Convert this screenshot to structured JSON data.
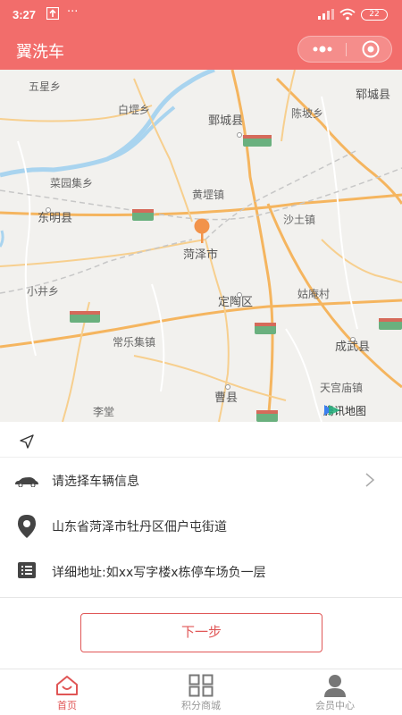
{
  "status_bar": {
    "time": "3:27",
    "ellipsis": "···",
    "battery": "22"
  },
  "title_bar": {
    "title": "翼洗车"
  },
  "map": {
    "labels": {
      "wuxingxiang": "五星乡",
      "baiduxiang": "白堽乡",
      "juanchengxian": "鄄城县",
      "chenpoxiang": "陈坡乡",
      "yunchengxian": "郓城县",
      "caiyuanjixiang": "菜园集乡",
      "huangdizhen": "黄堽镇",
      "dongmingxian": "东明县",
      "shatuzhen": "沙土镇",
      "hezeshi": "菏泽市",
      "xiaojingxiang": "小井乡",
      "dingtaoqu": "定陶区",
      "guanmiaocun": "姑庵村",
      "changlejizhen": "常乐集镇",
      "chengwuxian": "成武县",
      "caoxian": "曹县",
      "tiangongmiaozhen": "天宫庙镇",
      "litang": "李堂"
    },
    "watermark": "腾讯地图"
  },
  "form": {
    "vehicle_placeholder": "请选择车辆信息",
    "address": "山东省菏泽市牡丹区佃户屯街道",
    "detail_placeholder": "详细地址:如xx写字楼x栋停车场负一层"
  },
  "next_button": "下一步",
  "tabs": [
    {
      "label": "首页"
    },
    {
      "label": "积分商城"
    },
    {
      "label": "会员中心"
    }
  ],
  "colors": {
    "accent": "#f26d6b",
    "button": "#e05656"
  }
}
